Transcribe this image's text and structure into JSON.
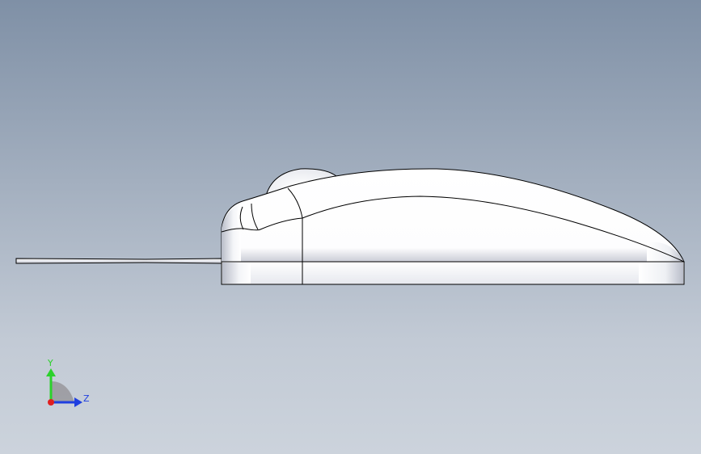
{
  "viewport": {
    "view": "side",
    "background_top": "#7f90a6",
    "background_bottom": "#ccd3dc"
  },
  "model": {
    "name": "mouse",
    "body_color": "#ffffff",
    "edge_color": "#000000",
    "shade_color": "#c9ccd6"
  },
  "triad": {
    "y_label": "Y",
    "z_label": "Z",
    "y_color": "#2bd12b",
    "z_color": "#1f3fe0",
    "x_color": "#e01f1f"
  }
}
